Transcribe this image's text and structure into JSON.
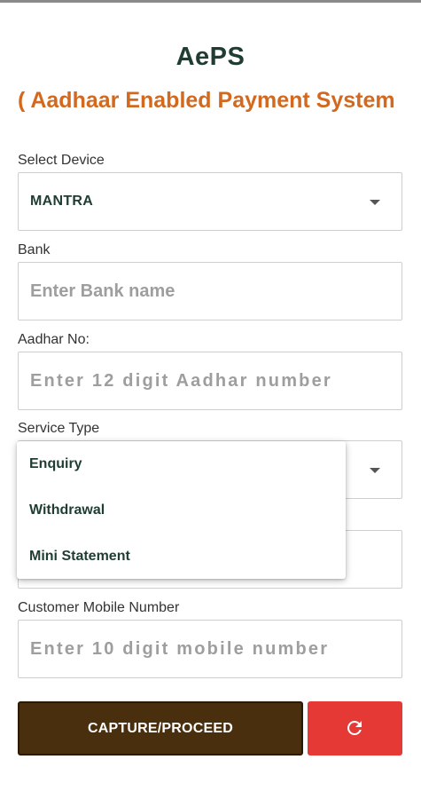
{
  "header": {
    "title": "AePS",
    "subtitle": "( Aadhaar Enabled Payment System"
  },
  "form": {
    "device": {
      "label": "Select Device",
      "value": "MANTRA"
    },
    "bank": {
      "label": "Bank",
      "placeholder": "Enter Bank name"
    },
    "aadhar": {
      "label": "Aadhar No:",
      "placeholder": "Enter 12 digit Aadhar number"
    },
    "service": {
      "label": "Service Type",
      "options": [
        "Enquiry",
        "Withdrawal",
        "Mini Statement"
      ]
    },
    "mobile": {
      "label": "Customer Mobile Number",
      "placeholder": "Enter 10 digit mobile number"
    }
  },
  "actions": {
    "capture_label": "CAPTURE/PROCEED",
    "refresh_icon": "refresh-icon"
  },
  "colors": {
    "title": "#1f3d33",
    "subtitle": "#d2691e",
    "capture_button": "#4a2f0e",
    "refresh_button": "#e53935"
  }
}
